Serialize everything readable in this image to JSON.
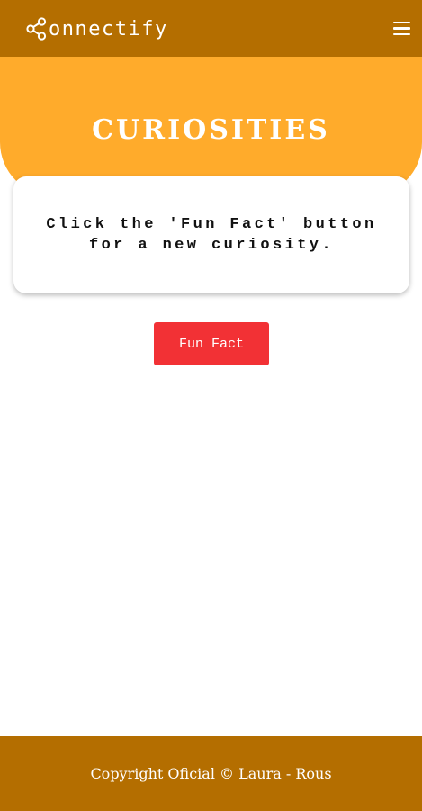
{
  "navbar": {
    "brand_text": "onnectify",
    "brand_icon": "share-icon",
    "menu_icon": "hamburger-menu-icon"
  },
  "hero": {
    "title": "CURIOSITIES"
  },
  "card": {
    "text": "Click the 'Fun Fact' button for a new curiosity."
  },
  "actions": {
    "fun_fact_label": "Fun Fact"
  },
  "footer": {
    "copyright": "Copyright Oficial © Laura - Rous"
  },
  "colors": {
    "header_footer": "#b46e00",
    "hero": "#ffab2b",
    "button": "#f23135",
    "text_light": "#ffffff"
  }
}
